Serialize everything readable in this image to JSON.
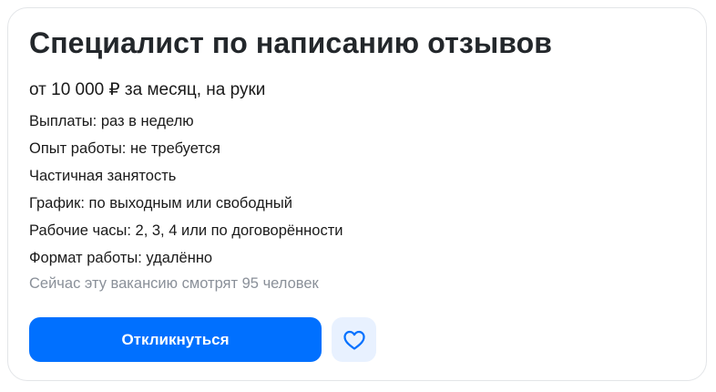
{
  "vacancy": {
    "title": "Специалист по написанию отзывов",
    "salary": "от 10 000 ₽ за месяц, на руки",
    "details": [
      "Выплаты: раз в неделю",
      "Опыт работы: не требуется",
      "Частичная занятость",
      "График: по выходным или свободный",
      "Рабочие часы: 2, 3, 4 или по договорённости",
      "Формат работы: удалённо"
    ],
    "viewers": "Сейчас эту вакансию смотрят 95 человек"
  },
  "actions": {
    "apply_label": "Откликнуться",
    "favorite_icon": "heart-outline-icon",
    "accent_color": "#0070ff",
    "favorite_bg_color": "#e8f1ff"
  }
}
